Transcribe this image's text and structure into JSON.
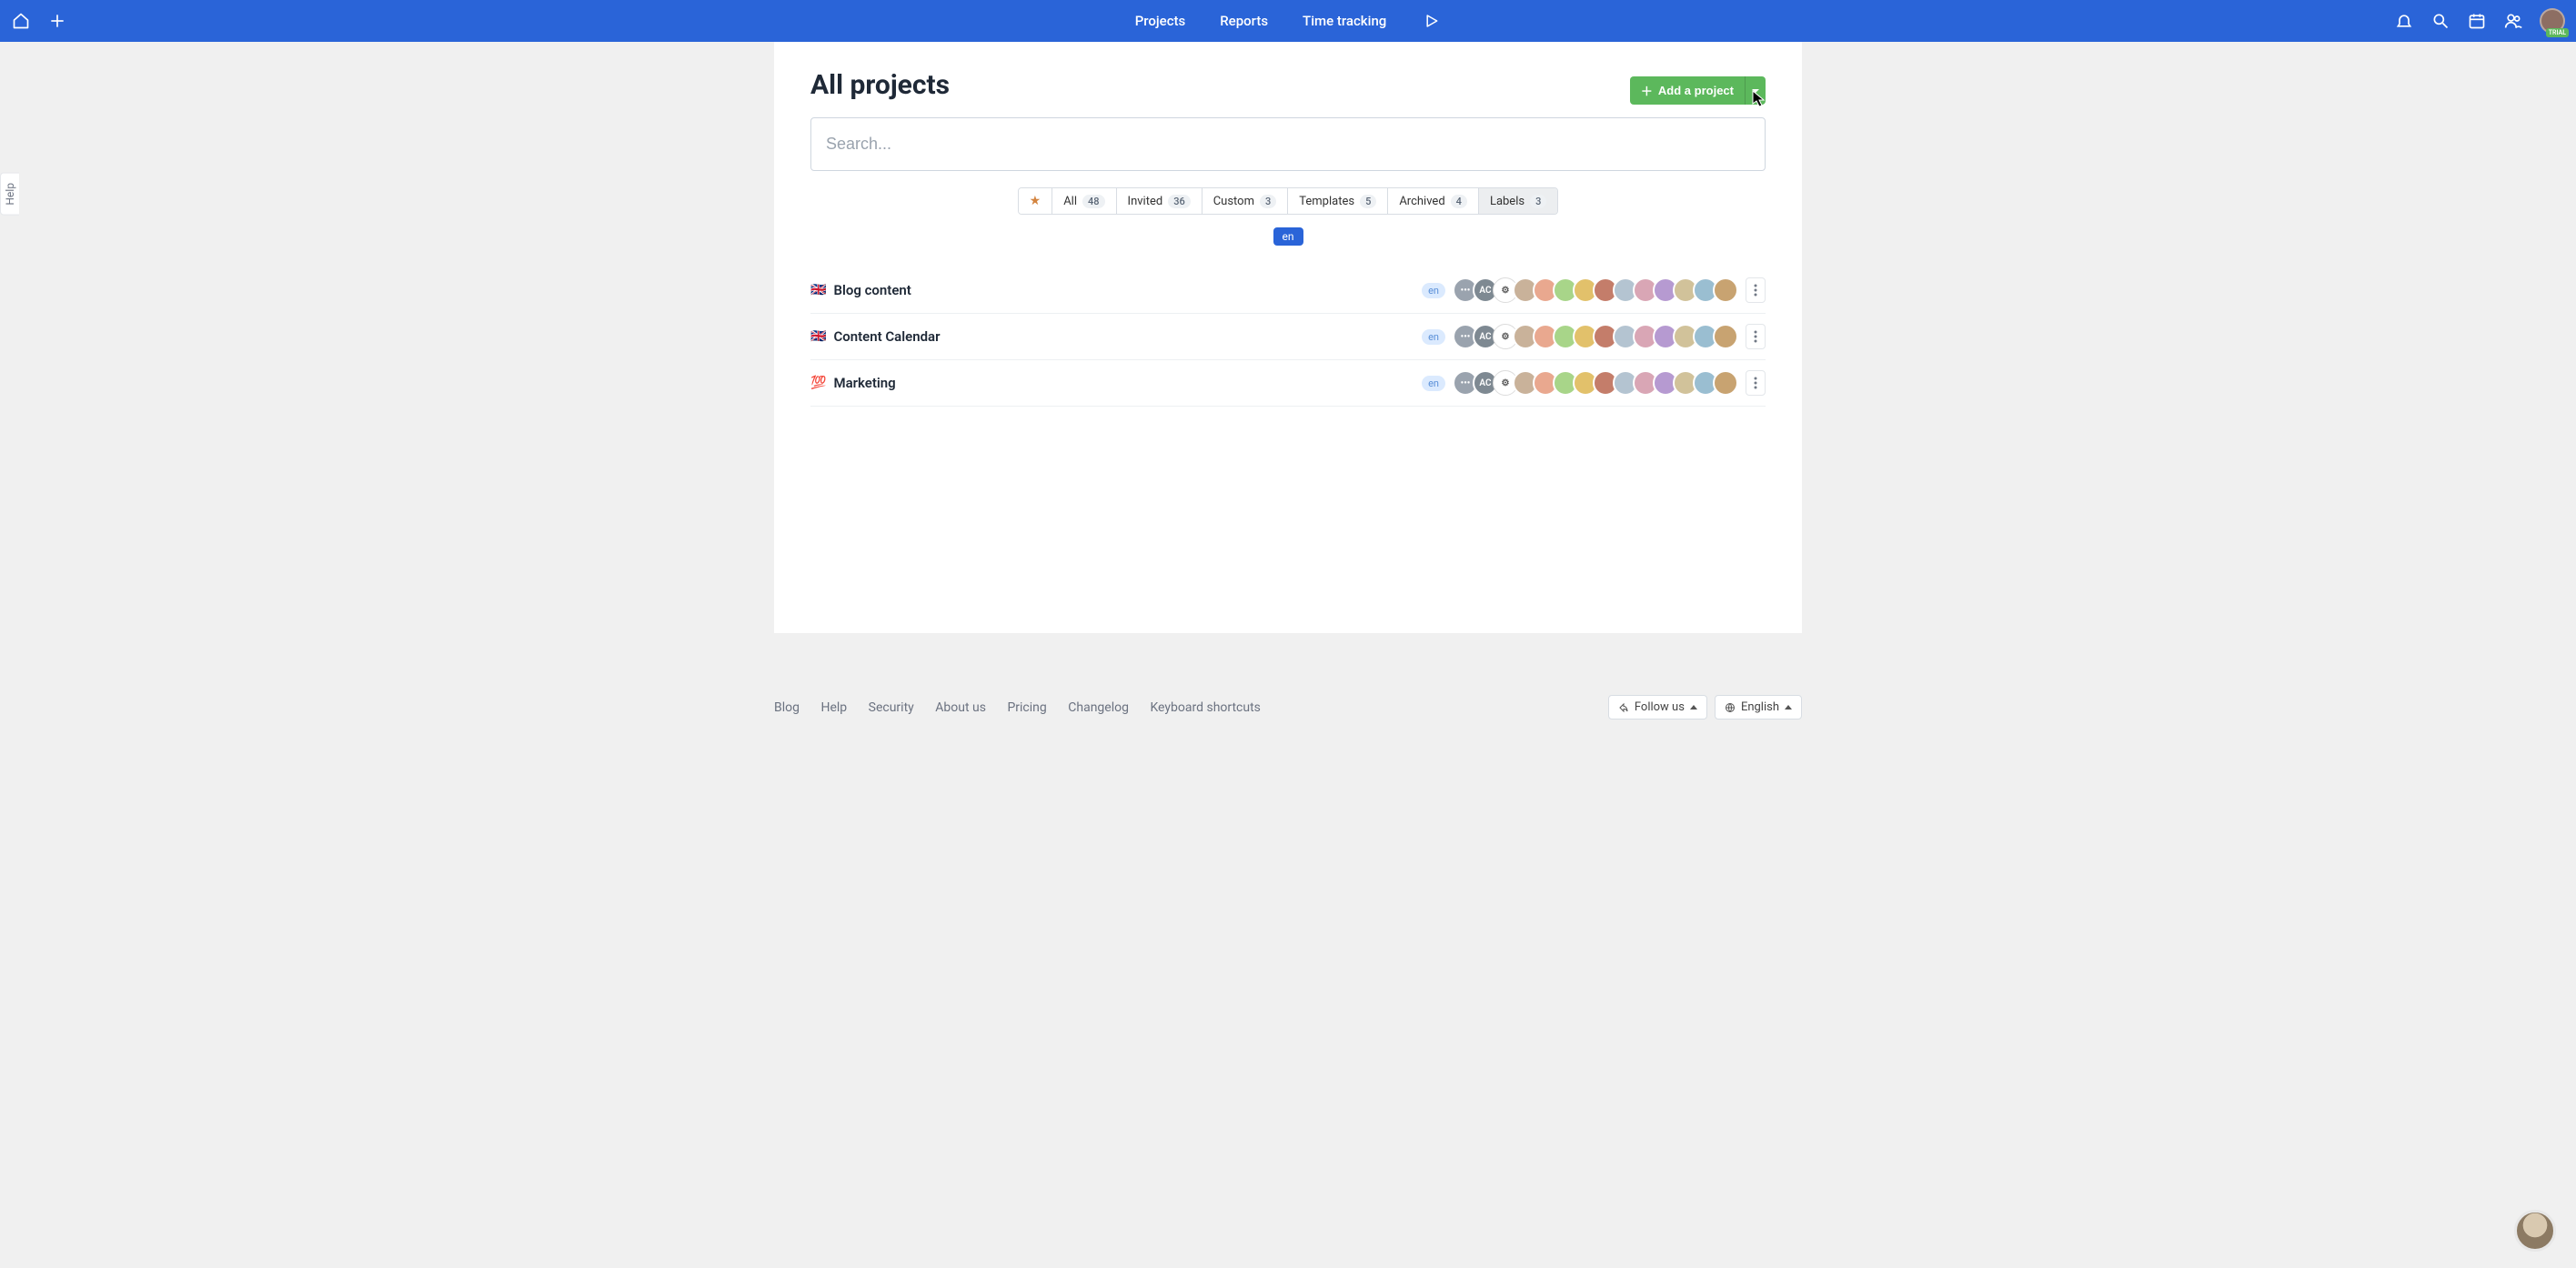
{
  "nav": {
    "projects": "Projects",
    "reports": "Reports",
    "time": "Time tracking"
  },
  "trial_badge": "TRIAL",
  "help_tab": "Help",
  "page": {
    "title": "All projects",
    "add_button": "Add a project",
    "search_placeholder": "Search..."
  },
  "filters": {
    "all": {
      "label": "All",
      "count": "48"
    },
    "invited": {
      "label": "Invited",
      "count": "36"
    },
    "custom": {
      "label": "Custom",
      "count": "3"
    },
    "templates": {
      "label": "Templates",
      "count": "5"
    },
    "archived": {
      "label": "Archived",
      "count": "4"
    },
    "labels": {
      "label": "Labels",
      "count": "3"
    }
  },
  "active_label": "en",
  "projects": [
    {
      "emoji": "🇬🇧",
      "name": "Blog content",
      "lang": "en",
      "more_text": "•••",
      "ac": "AC",
      "extra_avatars": 11
    },
    {
      "emoji": "🇬🇧",
      "name": "Content Calendar",
      "lang": "en",
      "more_text": "•••",
      "ac": "AC",
      "extra_avatars": 11
    },
    {
      "emoji": "💯",
      "name": "Marketing",
      "lang": "en",
      "more_text": "•••",
      "ac": "AC",
      "extra_avatars": 11
    }
  ],
  "footer": {
    "links": {
      "blog": "Blog",
      "help": "Help",
      "security": "Security",
      "about": "About us",
      "pricing": "Pricing",
      "changelog": "Changelog",
      "shortcuts": "Keyboard shortcuts"
    },
    "follow": "Follow us",
    "language": "English"
  },
  "avatar_colors": [
    "#c9b29a",
    "#e9a88f",
    "#a8d589",
    "#e2c16b",
    "#c47d6a",
    "#b4c4d1",
    "#d9a6b5",
    "#b69ad1",
    "#d1c29a",
    "#9abed1",
    "#c8a371"
  ]
}
